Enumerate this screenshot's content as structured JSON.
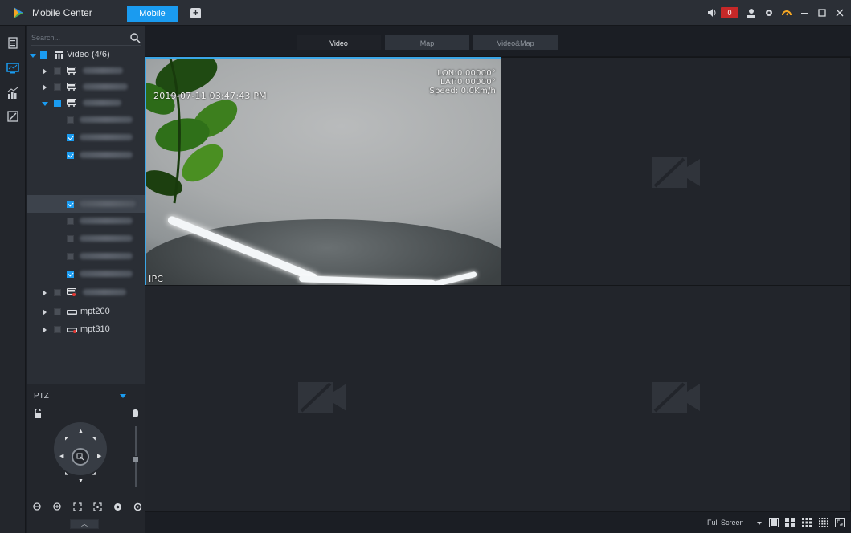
{
  "titlebar": {
    "app_name": "Mobile Center",
    "active_tab": "Mobile",
    "add_tab": "+",
    "alarm_count": "0"
  },
  "search": {
    "placeholder": "Search..."
  },
  "tree": {
    "root_label": "Video (4/6)",
    "devices": [
      {
        "label": "mpt200"
      },
      {
        "label": "mpt310"
      }
    ]
  },
  "ptz": {
    "title": "PTZ"
  },
  "view_tabs": [
    "Video",
    "Map",
    "Video&Map"
  ],
  "video": {
    "timestamp": "2019-07-11 03:47:43 PM",
    "lon": "LON:0.00000°",
    "lat": "LAT:0.00000°",
    "speed": "Speed: 0.0Km/h",
    "channel": "IPC"
  },
  "bottom": {
    "fullscreen_label": "Full Screen"
  },
  "colors": {
    "accent": "#1a9bf0",
    "selection_border": "#3ba6e6",
    "alarm": "#c62828"
  }
}
